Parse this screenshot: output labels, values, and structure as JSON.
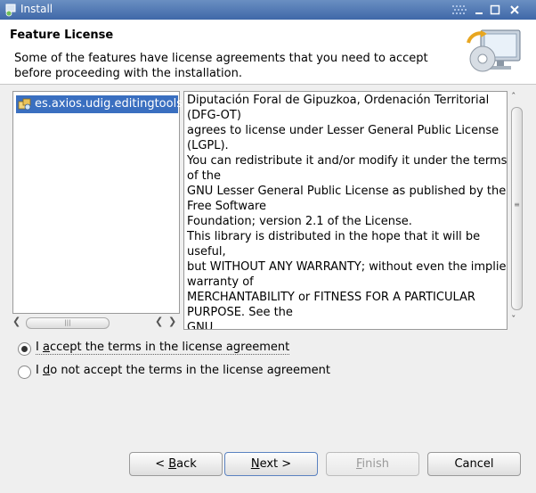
{
  "window": {
    "title": "Install"
  },
  "header": {
    "title": "Feature License",
    "description": "Some of the features have license agreements that you need to accept before proceeding with the installation."
  },
  "features": [
    {
      "label": "es.axios.udig.editingtools"
    }
  ],
  "license": {
    "lines": [
      "Diputación Foral de Gipuzkoa, Ordenación Territorial",
      "(DFG-OT)",
      "agrees to license under Lesser General Public License",
      "(LGPL).",
      "You can redistribute it and/or modify it under the terms",
      "of the",
      "GNU Lesser General Public License as published by the",
      "Free Software",
      "Foundation; version 2.1 of the License.",
      "This library is distributed in the hope that it will be",
      "useful,",
      "but WITHOUT ANY WARRANTY; without even the implied",
      "warranty of",
      "MERCHANTABILITY or FITNESS FOR A PARTICULAR",
      "PURPOSE.  See the",
      "GNU"
    ]
  },
  "options": {
    "accept": {
      "pre": "I ",
      "mnemonic": "a",
      "post": "ccept the terms in the license agreement",
      "selected": true
    },
    "decline": {
      "pre": "I ",
      "mnemonic": "d",
      "post": "o not accept the terms in the license agreement",
      "selected": false
    }
  },
  "buttons": {
    "back": {
      "pre": "< ",
      "mnemonic": "B",
      "post": "ack"
    },
    "next": {
      "pre": "",
      "mnemonic": "N",
      "post": "ext >"
    },
    "finish": {
      "pre": "",
      "mnemonic": "F",
      "post": "inish"
    },
    "cancel": {
      "label": "Cancel"
    }
  },
  "icons": {
    "app": "install-icon",
    "feature": "feature-icon",
    "banner": "install-wizard-banner-icon"
  },
  "colors": {
    "titlebar": "#4f77b4",
    "selection": "#3a6fc0",
    "accent": "#5a82c0"
  }
}
